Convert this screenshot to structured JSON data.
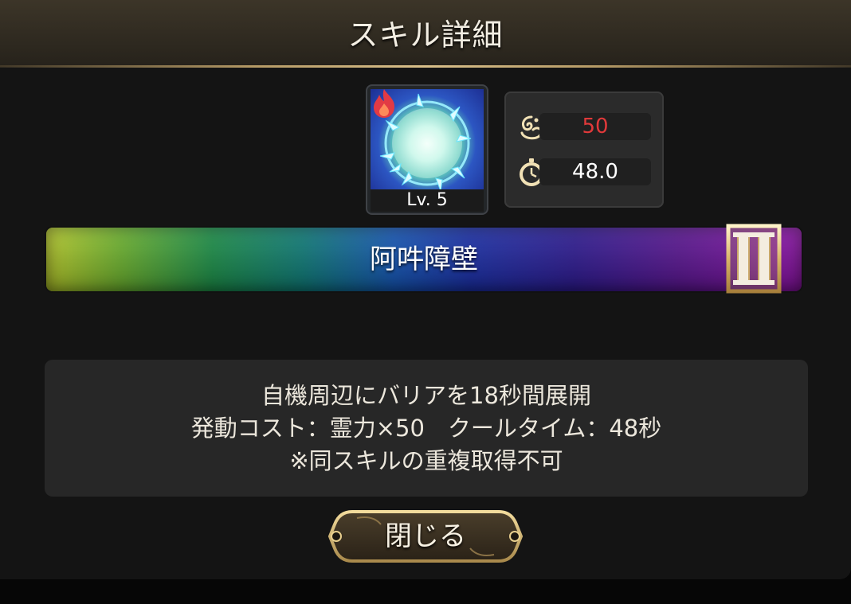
{
  "dialog": {
    "title": "スキル詳細",
    "close_label": "閉じる"
  },
  "skill": {
    "icon_name": "barrier-skill-icon",
    "element_icon": "fire-element-icon",
    "level": "Lv. 5",
    "name": "阿吽障壁",
    "grade": "II",
    "bar_colors": [
      "#b8cc2a",
      "#1b8e48",
      "#1456b5",
      "#2e1a92",
      "#8e12a8"
    ]
  },
  "stats": {
    "cost": {
      "icon": "spirit-power-icon",
      "value": "50",
      "color": "#e0393a"
    },
    "cooldown": {
      "icon": "stopwatch-icon",
      "value": "48.0",
      "color": "#ffffff"
    }
  },
  "description": {
    "lines": [
      "自機周辺にバリアを18秒間展開",
      "発動コスト：霊力×50　クールタイム：48秒",
      "※同スキルの重複取得不可"
    ]
  }
}
